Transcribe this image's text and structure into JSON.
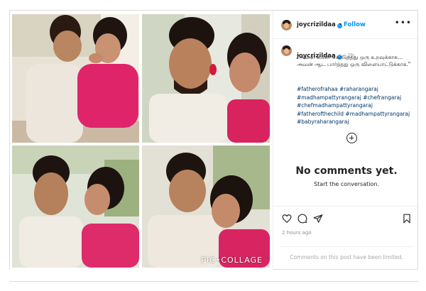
{
  "post": {
    "username": "joycrizildaa",
    "follow_label": "Follow",
    "separator": "•",
    "more_icon": "more-horizontal-icon",
    "caption": {
      "username": "joycrizildaa",
      "time": "2h",
      "text": "\"அவள் உயிர் கொடுத்தது ஒரு உறவுக்காக… அவன் ஆட பார்த்தது ஒரு விளையாட்டுக்காக.\"",
      "hashtags": [
        "#fatherofrahaa",
        "#raharangaraj",
        "#madhampattyrangaraj",
        "#chefrangaraj",
        "#chefmadhampattyrangaraj",
        "#fatherofthechild",
        "#madhampattyrangaraj",
        "#babyraharangaraj"
      ]
    },
    "empty_state": {
      "title": "No comments yet.",
      "subtitle": "Start the conversation."
    },
    "actions": {
      "like_icon": "heart-icon",
      "comment_icon": "comment-icon",
      "share_icon": "paper-plane-icon",
      "save_icon": "bookmark-icon",
      "time_ago": "2 hours ago"
    },
    "comments_limited": "Comments on this post have been limited.",
    "collage_watermark": "PIC•COLLAGE"
  },
  "colors": {
    "link_blue": "#0095f6",
    "hashtag_blue": "#00376b",
    "verified_blue": "#1d9bf0",
    "muted_gray": "#8e8e8e",
    "border": "#dbdbdb"
  }
}
